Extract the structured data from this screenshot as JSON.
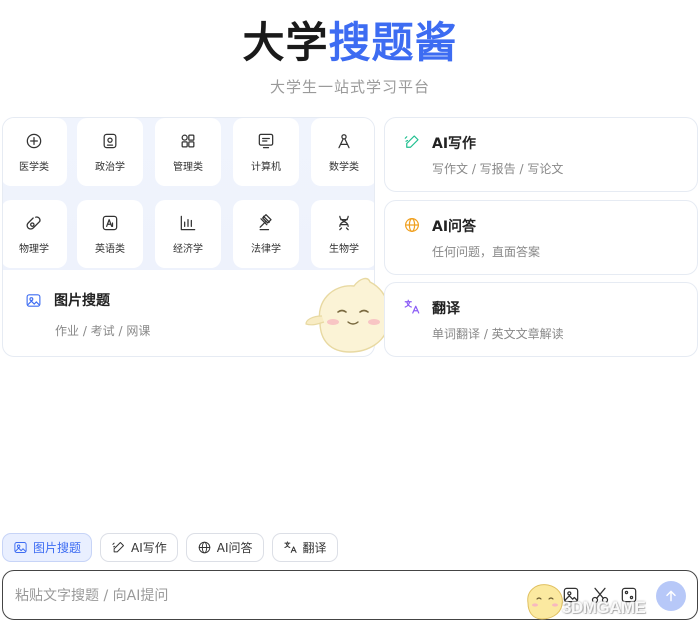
{
  "header": {
    "title_dark": "大学",
    "title_blue": "搜题酱",
    "subtitle": "大学生一站式学习平台"
  },
  "categories": [
    {
      "label": "医学类",
      "icon": "medical-icon"
    },
    {
      "label": "政治学",
      "icon": "politics-icon"
    },
    {
      "label": "管理类",
      "icon": "grid-icon"
    },
    {
      "label": "计算机",
      "icon": "computer-icon"
    },
    {
      "label": "数学类",
      "icon": "compass-icon"
    },
    {
      "label": "物理学",
      "icon": "physics-icon"
    },
    {
      "label": "英语类",
      "icon": "english-icon"
    },
    {
      "label": "经济学",
      "icon": "chart-icon"
    },
    {
      "label": "法律学",
      "icon": "gavel-icon"
    },
    {
      "label": "生物学",
      "icon": "dna-icon"
    }
  ],
  "image_search": {
    "title": "图片搜题",
    "subtitle": "作业 / 考试 / 网课"
  },
  "feature_cards": [
    {
      "title": "AI写作",
      "subtitle": "写作文 / 写报告 / 写论文",
      "icon": "pen-icon",
      "color": "#1fbf8f"
    },
    {
      "title": "AI问答",
      "subtitle": "任何问题，直面答案",
      "icon": "globe-icon",
      "color": "#f0a020"
    },
    {
      "title": "翻译",
      "subtitle": "单词翻译 / 英文文章解读",
      "icon": "translate-icon",
      "color": "#8b5cf6"
    }
  ],
  "tabs": [
    {
      "label": "图片搜题",
      "icon": "image-icon",
      "active": true
    },
    {
      "label": "AI写作",
      "icon": "pen-icon",
      "active": false
    },
    {
      "label": "AI问答",
      "icon": "globe-icon",
      "active": false
    },
    {
      "label": "翻译",
      "icon": "translate-icon",
      "active": false
    }
  ],
  "input": {
    "placeholder": "粘贴文字搜题 / 向AI提问"
  },
  "watermark": "3DMGAME",
  "colors": {
    "accent": "#3d6cf2",
    "send_button": "#b7c8f8"
  }
}
